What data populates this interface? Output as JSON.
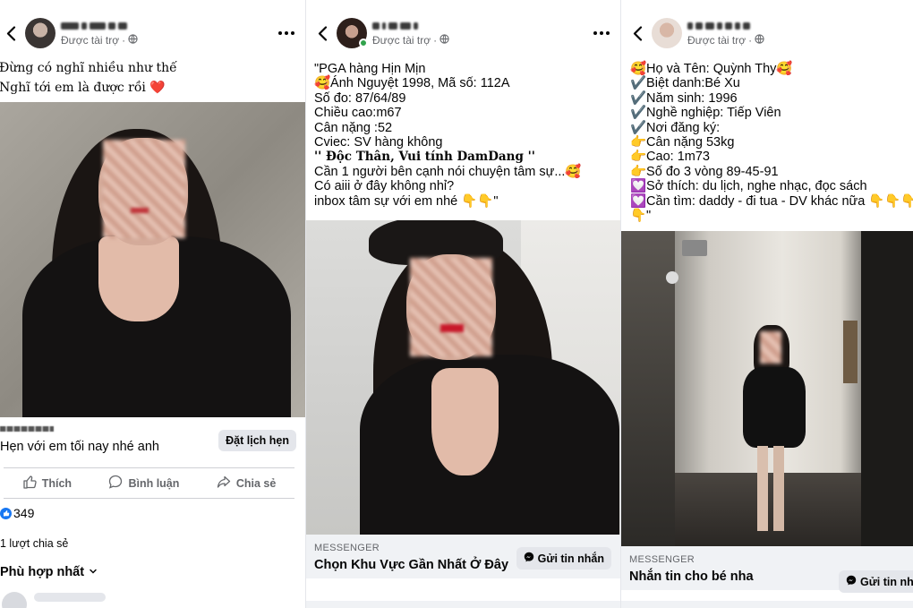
{
  "panels": [
    {
      "sponsored": "Được tài trợ",
      "caption_lines": [
        "Đừng có nghĩ nhiều như thế",
        "Nghĩ tới em là được rồi ❤️"
      ],
      "cta": {
        "headline": "Hẹn với em tối nay nhé anh",
        "button": "Đặt lịch hẹn"
      },
      "actions": {
        "like": "Thích",
        "comment": "Bình luận",
        "share": "Chia sẻ"
      },
      "reactions_count": "349",
      "shares": "1 lượt chia sẻ",
      "sort": "Phù hợp nhất"
    },
    {
      "sponsored": "Được tài trợ",
      "caption_lines": [
        "\"PGA  hàng Hịn Mịn",
        "🥰Ánh Nguyệt 1998, Mã số: 112A",
        "Số đo: 87/64/89",
        "Chiều cao:m67",
        "Cân nặng :52",
        "Cviec: SV hàng không",
        "'' Độc Thân, Vui tính DamDang ''",
        "Cần 1 người bên cạnh nói chuyện tâm sự...🥰",
        "Có aiii ở đây không nhỉ?",
        "inbox tâm sự với em nhé 👇👇\""
      ],
      "cta": {
        "source": "MESSENGER",
        "headline": "Chọn Khu Vực Gần Nhất Ở Đây",
        "button": "Gửi tin nhắn"
      }
    },
    {
      "sponsored": "Được tài trợ",
      "caption_lines": [
        "🥰Họ và Tên: Quỳnh Thy🥰",
        "✔️Biệt danh:Bé Xu",
        "✔️Năm sinh: 1996",
        "✔️Nghề nghiệp: Tiếp Viên",
        "✔️Nơi đăng ký:",
        "👉Cân nặng 53kg",
        "👉Cao: 1m73",
        "👉Số đo 3 vòng 89-45-91",
        "💟Sở thích: du lịch, nghe nhạc, đọc sách",
        "💟Cần tìm: daddy - đi tua - DV khác nữa 👇👇👇",
        "👇\""
      ],
      "cta": {
        "source": "MESSENGER",
        "headline": "Nhắn tin cho bé nha",
        "button": "Gửi tin nhắ"
      }
    }
  ],
  "icons": [
    "back-chevron-icon",
    "globe-icon",
    "more-dots-icon",
    "thumbs-up-icon",
    "comment-bubble-icon",
    "share-arrow-icon",
    "messenger-icon",
    "chevron-down-icon"
  ],
  "colors": {
    "facebook_blue": "#1877f2",
    "secondary_text": "#65676b",
    "cta_background": "#f0f2f5",
    "button_gray": "#e4e6eb",
    "online_green": "#31a24c"
  }
}
